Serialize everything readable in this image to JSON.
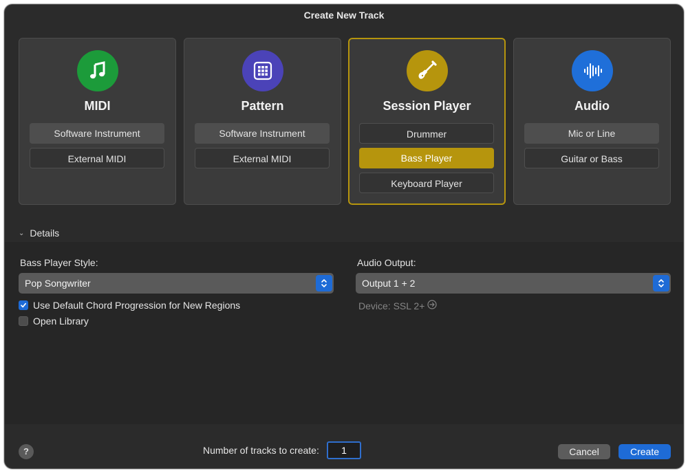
{
  "window": {
    "title": "Create New Track"
  },
  "cards": [
    {
      "title": "MIDI",
      "icon": "music-note-icon",
      "color": "#1c9b3a",
      "options": [
        "Software Instrument",
        "External MIDI"
      ]
    },
    {
      "title": "Pattern",
      "icon": "grid-pads-icon",
      "color": "#4b43b8",
      "options": [
        "Software Instrument",
        "External MIDI"
      ]
    },
    {
      "title": "Session Player",
      "icon": "guitar-icon",
      "color": "#b6950d",
      "selected": true,
      "options": [
        "Drummer",
        "Bass Player",
        "Keyboard Player"
      ],
      "active_option": "Bass Player"
    },
    {
      "title": "Audio",
      "icon": "waveform-icon",
      "color": "#1f6fd9",
      "options": [
        "Mic or Line",
        "Guitar or Bass"
      ]
    }
  ],
  "details": {
    "toggle_label": "Details",
    "style_label": "Bass Player Style:",
    "style_value": "Pop Songwriter",
    "output_label": "Audio Output:",
    "output_value": "Output 1 + 2",
    "device_text": "Device: SSL 2+",
    "checkbox_chord_label": "Use Default Chord Progression for New Regions",
    "checkbox_chord_checked": true,
    "checkbox_library_label": "Open Library",
    "checkbox_library_checked": false
  },
  "footer": {
    "help": "?",
    "count_label": "Number of tracks to create:",
    "count_value": "1",
    "cancel_label": "Cancel",
    "create_label": "Create"
  },
  "colors": {
    "accent": "#1e6bd6",
    "selection": "#b6950d"
  }
}
